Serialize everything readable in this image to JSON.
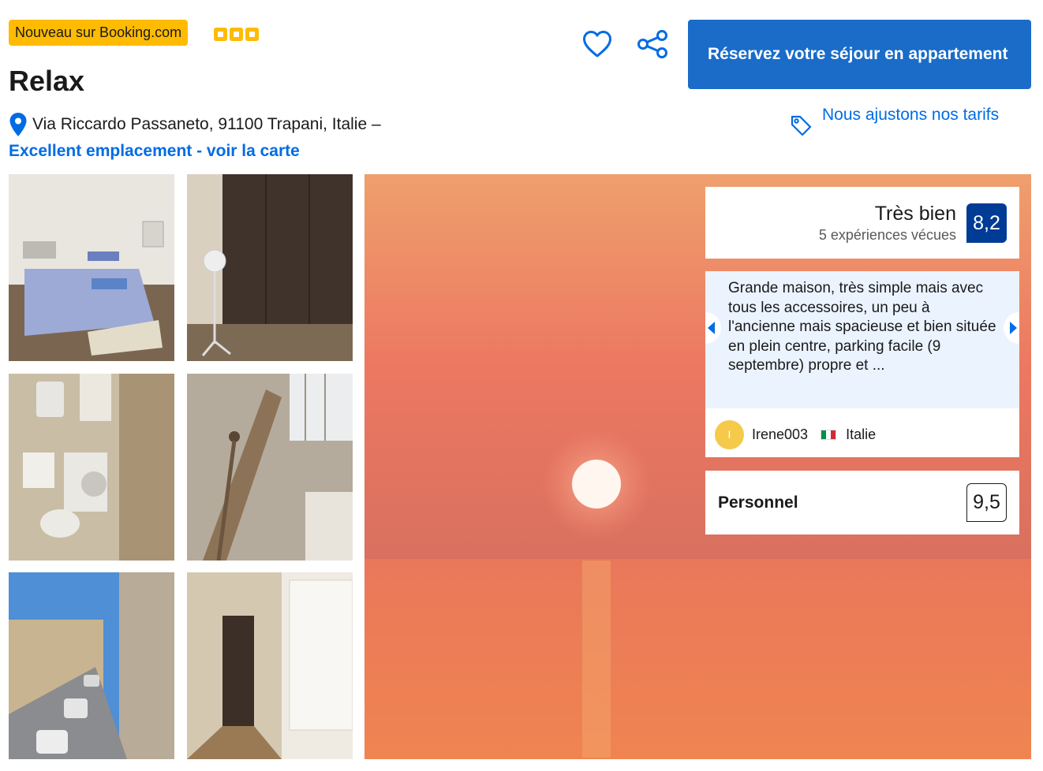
{
  "header": {
    "badge": "Nouveau sur Booking.com",
    "star_count": 3,
    "title": "Relax",
    "address": "Via Riccardo Passaneto, 91100 Trapani, Italie –",
    "location_link": "Excellent emplacement - voir la carte",
    "reserve_button": "Réservez votre séjour en appartement",
    "price_match": "Nous ajustons nos tarifs"
  },
  "icons": {
    "stars": "square-star-icon",
    "pin": "map-pin-icon",
    "favorite": "heart-icon",
    "share": "share-icon",
    "price": "price-tag-icon"
  },
  "colors": {
    "brand_blue": "#006ce4",
    "reserve_button": "#1a6cc8",
    "score_badge": "#003b95",
    "badge_yellow": "#febb02",
    "review_background": "#ebf3ff"
  },
  "rating": {
    "label": "Très bien",
    "count": "5 expériences vécues",
    "score": "8,2"
  },
  "review": {
    "text": "Grande maison, très simple mais avec tous les accessoires, un peu à l'ancienne mais spacieuse et bien située en plein centre, parking facile (9 septembre) propre et ...",
    "avatar_letter": "I",
    "reviewer_name": "Irene003",
    "reviewer_country": "Italie"
  },
  "category_score": {
    "label": "Personnel",
    "score": "9,5"
  }
}
